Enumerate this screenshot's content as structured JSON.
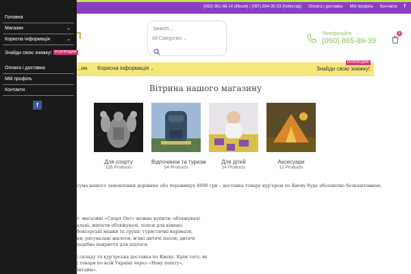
{
  "topbar": {
    "phones": "(063) 981-68-14 (lifecell) / (097) 894-35-53 (Київстар)",
    "links": [
      "Оплата і доставка",
      "Мій профіль",
      "Контакти"
    ],
    "facebook": "f"
  },
  "header": {
    "search_placeholder": "Search...",
    "category_select": "All Categories",
    "phone_label": "Телефонуйте",
    "phone_number": "(050) 865-89-39",
    "cart_count": "0"
  },
  "navbar": {
    "items": [
      "...ин",
      "Корисна інформація"
    ],
    "discount_label": "Знайди свою знижку!",
    "discount_tag": "РОЗПРОДАЖ"
  },
  "showcase": {
    "title": "Вітрина нашого магазину",
    "categories": [
      {
        "name": "Для спорту",
        "count": "126 Products"
      },
      {
        "name": "Відпочинок та туризм",
        "count": "54 Products"
      },
      {
        "name": "Для дітей",
        "count": "24 Products"
      },
      {
        "name": "Аксесуари",
        "count": "12 Products"
      }
    ]
  },
  "content": {
    "delivery_note": "сума вашого замовлення дорівнює або перевищує 4000 грн – доставка товару кур'єром по Києву буде абсолютно безкоштовною.",
    "about_lines": [
      "т- магазині «Спорт Опт» можна купити: обтяжувачі",
      "альні, жилети-обтяжувачі, пояси для кімоно,",
      "боксерські мішки та груші; туристичні карімати,",
      "ки, рятувальні жилети; м'які дитячі пазли, дитячі",
      "подібне покриття для підлоги."
    ],
    "about_lines_2": [
      "і складу та кур'єрська доставка по Києву. Крім того, ми",
      "і товари по всій Україні через «Нову пошту»,",
      "Інтайм»."
    ]
  },
  "sidebar": {
    "items": [
      {
        "label": "Головна"
      },
      {
        "label": "Магазин"
      },
      {
        "label": "Корисна інформація"
      },
      {
        "label": "Знайди свою знижку!",
        "tag": "РОЗПРОДАЖ"
      },
      {
        "label": "Оплата і доставка"
      },
      {
        "label": "Мій профіль"
      },
      {
        "label": "Контакти"
      }
    ],
    "facebook": "f"
  },
  "colors": {
    "topbar": "#8a3fc5",
    "navbar": "#f5e77a",
    "sidebar": "#1a1a1a",
    "accent_green": "#8cbf5a",
    "sale_pink": "#e0307a"
  }
}
